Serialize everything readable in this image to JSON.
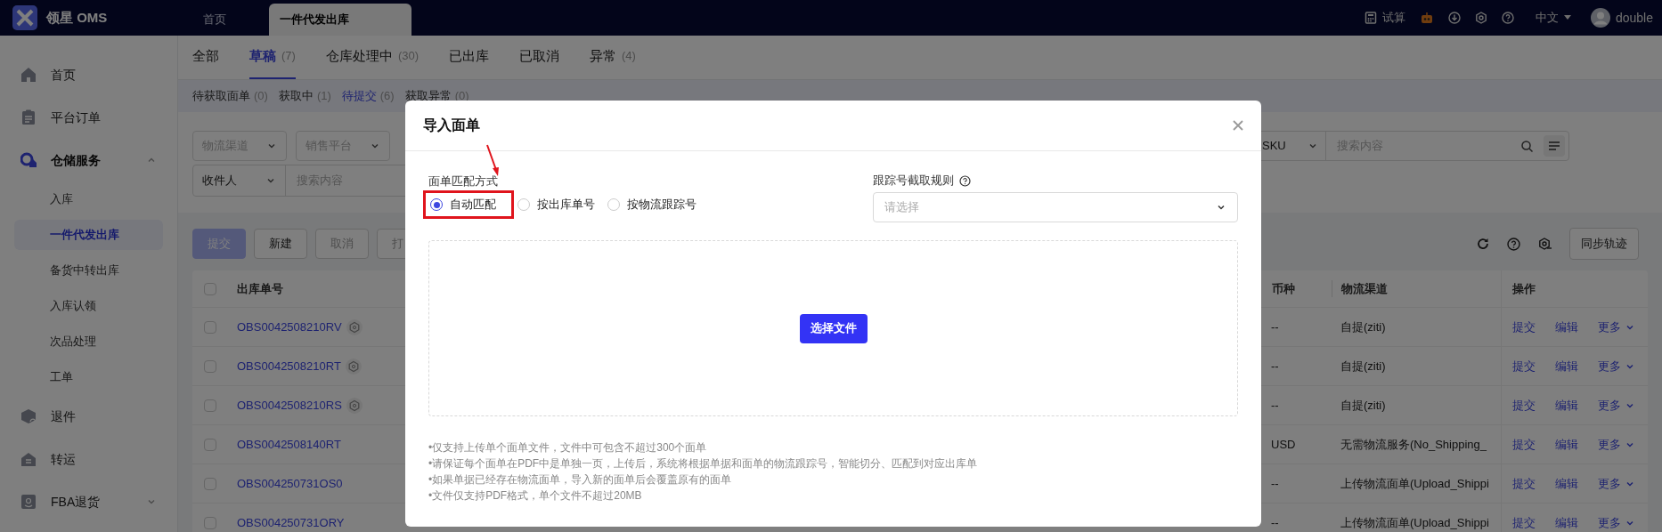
{
  "topbar": {
    "app_name": "领星 OMS",
    "tabs": [
      {
        "label": "首页",
        "selected": false
      },
      {
        "label": "一件代发出库",
        "selected": true
      }
    ],
    "tools": [
      {
        "kind": "calc",
        "label": "试算"
      },
      {
        "kind": "robot"
      },
      {
        "kind": "download"
      },
      {
        "kind": "settings"
      },
      {
        "kind": "help"
      }
    ],
    "language": "中文",
    "user": "double"
  },
  "sidebar": {
    "items": [
      {
        "kind": "link",
        "label": "首页",
        "selected": false
      },
      {
        "kind": "link",
        "label": "平台订单",
        "selected": false
      },
      {
        "kind": "group",
        "label": "仓储服务",
        "selected": true,
        "expanded": true,
        "children": [
          {
            "label": "入库",
            "selected": false
          },
          {
            "label": "一件代发出库",
            "selected": true
          },
          {
            "label": "备货中转出库",
            "selected": false
          },
          {
            "label": "入库认领",
            "selected": false
          },
          {
            "label": "次品处理",
            "selected": false
          },
          {
            "label": "工单",
            "selected": false
          }
        ]
      },
      {
        "kind": "link",
        "label": "退件",
        "selected": false
      },
      {
        "kind": "link",
        "label": "转运",
        "selected": false
      },
      {
        "kind": "group",
        "label": "FBA退货",
        "selected": false,
        "expanded": false
      }
    ]
  },
  "status_tabs": [
    {
      "label": "全部",
      "selected": false
    },
    {
      "label": "草稿",
      "count": "(7)",
      "selected": true
    },
    {
      "label": "仓库处理中",
      "count": "(30)",
      "selected": false
    },
    {
      "label": "已出库",
      "selected": false
    },
    {
      "label": "已取消",
      "selected": false
    },
    {
      "label": "异常",
      "count": "(4)",
      "selected": false
    }
  ],
  "sub_tabs": [
    {
      "label": "待获取面单",
      "count": "(0)",
      "selected": false
    },
    {
      "label": "获取中",
      "count": "(1)",
      "selected": false
    },
    {
      "label": "待提交",
      "count": "(6)",
      "selected": true
    },
    {
      "label": "获取异常",
      "count": "(0)",
      "selected": false
    }
  ],
  "filters": {
    "selects": [
      {
        "placeholder": "物流渠道"
      },
      {
        "placeholder": "销售平台"
      }
    ],
    "search_right": {
      "field": "SKU",
      "placeholder": "搜索内容"
    },
    "search_left": {
      "field": "收件人",
      "placeholder": "搜索内容"
    }
  },
  "toolbar": {
    "buttons": [
      {
        "label": "提交",
        "kind": "primary",
        "disabled": true
      },
      {
        "label": "新建",
        "kind": "default",
        "disabled": false
      },
      {
        "label": "取消",
        "kind": "default",
        "disabled": true
      },
      {
        "label": "打",
        "kind": "default",
        "disabled": true
      }
    ],
    "sync_button": "同步轨迹"
  },
  "table": {
    "columns": [
      "出库单号",
      "币种",
      "物流渠道",
      "操作"
    ],
    "header_checked": false,
    "rows": [
      {
        "checked": false,
        "order": "OBS0042508210RV",
        "tagged": true,
        "currency": "--",
        "channel": "自提(ziti)",
        "actions": [
          "提交",
          "编辑",
          "更多"
        ]
      },
      {
        "checked": false,
        "order": "OBS0042508210RT",
        "tagged": true,
        "currency": "--",
        "channel": "自提(ziti)",
        "actions": [
          "提交",
          "编辑",
          "更多"
        ]
      },
      {
        "checked": false,
        "order": "OBS0042508210RS",
        "tagged": true,
        "currency": "--",
        "channel": "自提(ziti)",
        "actions": [
          "提交",
          "编辑",
          "更多"
        ]
      },
      {
        "checked": false,
        "order": "OBS0042508140RT",
        "tagged": false,
        "currency": "USD",
        "channel": "无需物流服务(No_Shipping_",
        "actions": [
          "提交",
          "编辑",
          "更多"
        ]
      },
      {
        "checked": false,
        "order": "OBS004250731OS0",
        "tagged": false,
        "currency": "--",
        "channel": "上传物流面单(Upload_Shippi",
        "actions": [
          "提交",
          "编辑",
          "更多"
        ]
      },
      {
        "checked": false,
        "order": "OBS004250731ORY",
        "tagged": false,
        "currency": "--",
        "channel": "上传物流面单(Upload_Shippi",
        "actions": [
          "提交",
          "编辑",
          "更多"
        ]
      }
    ]
  },
  "modal": {
    "title": "导入面单",
    "match_label": "面单匹配方式",
    "options": [
      {
        "label": "自动匹配",
        "selected": true
      },
      {
        "label": "按出库单号",
        "selected": false
      },
      {
        "label": "按物流跟踪号",
        "selected": false
      }
    ],
    "rule_label": "跟踪号截取规则",
    "rule_placeholder": "请选择",
    "upload_button": "选择文件",
    "notes": [
      "•仅支持上传单个面单文件，文件中可包含不超过300个面单",
      "•请保证每个面单在PDF中是单独一页，上传后，系统将根据单据和面单的物流跟踪号，智能切分、匹配到对应出库单",
      "•如果单据已经存在物流面单，导入新的面单后会覆盖原有的面单",
      "•文件仅支持PDF格式，单个文件不超过20MB"
    ]
  }
}
